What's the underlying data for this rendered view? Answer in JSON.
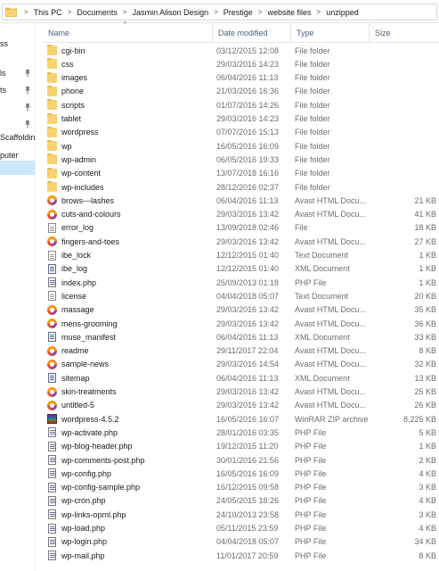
{
  "breadcrumbs": [
    "This PC",
    "Documents",
    "Jasmin Alison Design",
    "Prestige",
    "website files",
    "unzipped"
  ],
  "breadcrumb_separator": ">",
  "nav_pane": [
    {
      "label": "ss",
      "pinned": false,
      "selected": false
    },
    {
      "label": "ls",
      "pinned": true,
      "selected": false
    },
    {
      "label": "ts",
      "pinned": true,
      "selected": false
    },
    {
      "label": "",
      "pinned": true,
      "selected": false
    },
    {
      "label": "",
      "pinned": true,
      "selected": false
    },
    {
      "label": "Scaffoldin",
      "pinned": false,
      "selected": false
    },
    {
      "label": "puter",
      "pinned": false,
      "selected": false
    },
    {
      "label": "",
      "pinned": false,
      "selected": true
    }
  ],
  "columns": {
    "name": "Name",
    "date": "Date modified",
    "type": "Type",
    "size": "Size",
    "sort_indicator": "^"
  },
  "files": [
    {
      "name": "cgi-bin",
      "date": "03/12/2015 12:08",
      "type": "File folder",
      "size": "",
      "icon": "folder-icon"
    },
    {
      "name": "css",
      "date": "29/03/2016 14:23",
      "type": "File folder",
      "size": "",
      "icon": "folder-icon"
    },
    {
      "name": "images",
      "date": "06/04/2016 11:13",
      "type": "File folder",
      "size": "",
      "icon": "folder-icon"
    },
    {
      "name": "phone",
      "date": "21/03/2016 16:36",
      "type": "File folder",
      "size": "",
      "icon": "folder-icon"
    },
    {
      "name": "scripts",
      "date": "01/07/2016 14:26",
      "type": "File folder",
      "size": "",
      "icon": "folder-icon"
    },
    {
      "name": "tablet",
      "date": "29/03/2016 14:23",
      "type": "File folder",
      "size": "",
      "icon": "folder-icon"
    },
    {
      "name": "wordpress",
      "date": "07/07/2016 15:13",
      "type": "File folder",
      "size": "",
      "icon": "folder-icon"
    },
    {
      "name": "wp",
      "date": "16/05/2016 16:09",
      "type": "File folder",
      "size": "",
      "icon": "folder-icon"
    },
    {
      "name": "wp-admin",
      "date": "06/05/2016 19:33",
      "type": "File folder",
      "size": "",
      "icon": "folder-icon"
    },
    {
      "name": "wp-content",
      "date": "13/07/2018 16:16",
      "type": "File folder",
      "size": "",
      "icon": "folder-icon"
    },
    {
      "name": "wp-includes",
      "date": "28/12/2016 02:37",
      "type": "File folder",
      "size": "",
      "icon": "folder-icon"
    },
    {
      "name": "brows---lashes",
      "date": "06/04/2016 11:13",
      "type": "Avast HTML Docu...",
      "size": "21 KB",
      "icon": "avast-html-icon"
    },
    {
      "name": "cuts-and-colours",
      "date": "29/03/2016 13:42",
      "type": "Avast HTML Docu...",
      "size": "41 KB",
      "icon": "avast-html-icon"
    },
    {
      "name": "error_log",
      "date": "13/09/2018 02:46",
      "type": "File",
      "size": "18 KB",
      "icon": "document-icon"
    },
    {
      "name": "fingers-and-toes",
      "date": "29/03/2016 13:42",
      "type": "Avast HTML Docu...",
      "size": "27 KB",
      "icon": "avast-html-icon"
    },
    {
      "name": "ibe_lock",
      "date": "12/12/2015 01:40",
      "type": "Text Document",
      "size": "1 KB",
      "icon": "document-icon"
    },
    {
      "name": "ibe_log",
      "date": "12/12/2015 01:40",
      "type": "XML Document",
      "size": "1 KB",
      "icon": "xml-icon"
    },
    {
      "name": "index.php",
      "date": "25/09/2013 01:18",
      "type": "PHP File",
      "size": "1 KB",
      "icon": "php-icon"
    },
    {
      "name": "license",
      "date": "04/04/2018 05:07",
      "type": "Text Document",
      "size": "20 KB",
      "icon": "document-icon"
    },
    {
      "name": "massage",
      "date": "29/03/2016 13:42",
      "type": "Avast HTML Docu...",
      "size": "35 KB",
      "icon": "avast-html-icon"
    },
    {
      "name": "mens-grooming",
      "date": "29/03/2016 13:42",
      "type": "Avast HTML Docu...",
      "size": "36 KB",
      "icon": "avast-html-icon"
    },
    {
      "name": "muse_manifest",
      "date": "06/04/2016 11:13",
      "type": "XML Document",
      "size": "33 KB",
      "icon": "xml-icon"
    },
    {
      "name": "readme",
      "date": "29/11/2017 22:04",
      "type": "Avast HTML Docu...",
      "size": "8 KB",
      "icon": "avast-html-icon"
    },
    {
      "name": "sample-news",
      "date": "29/03/2016 14:54",
      "type": "Avast HTML Docu...",
      "size": "32 KB",
      "icon": "avast-html-icon"
    },
    {
      "name": "sitemap",
      "date": "06/04/2016 11:13",
      "type": "XML Document",
      "size": "13 KB",
      "icon": "xml-icon"
    },
    {
      "name": "skin-treatments",
      "date": "29/03/2016 13:42",
      "type": "Avast HTML Docu...",
      "size": "25 KB",
      "icon": "avast-html-icon"
    },
    {
      "name": "untitled-5",
      "date": "29/03/2016 13:42",
      "type": "Avast HTML Docu...",
      "size": "26 KB",
      "icon": "avast-html-icon"
    },
    {
      "name": "wordpress-4.5.2",
      "date": "16/05/2016 16:07",
      "type": "WinRAR ZIP archive",
      "size": "8,225 KB",
      "icon": "zip-archive-icon"
    },
    {
      "name": "wp-activate.php",
      "date": "28/01/2016 03:35",
      "type": "PHP File",
      "size": "5 KB",
      "icon": "php-icon"
    },
    {
      "name": "wp-blog-header.php",
      "date": "19/12/2015 11:20",
      "type": "PHP File",
      "size": "1 KB",
      "icon": "php-icon"
    },
    {
      "name": "wp-comments-post.php",
      "date": "30/01/2016 21:56",
      "type": "PHP File",
      "size": "2 KB",
      "icon": "php-icon"
    },
    {
      "name": "wp-config.php",
      "date": "16/05/2016 16:09",
      "type": "PHP File",
      "size": "4 KB",
      "icon": "php-icon"
    },
    {
      "name": "wp-config-sample.php",
      "date": "16/12/2015 09:58",
      "type": "PHP File",
      "size": "3 KB",
      "icon": "php-icon"
    },
    {
      "name": "wp-cron.php",
      "date": "24/05/2015 18:26",
      "type": "PHP File",
      "size": "4 KB",
      "icon": "php-icon"
    },
    {
      "name": "wp-links-opml.php",
      "date": "24/10/2013 23:58",
      "type": "PHP File",
      "size": "3 KB",
      "icon": "php-icon"
    },
    {
      "name": "wp-load.php",
      "date": "05/11/2015 23:59",
      "type": "PHP File",
      "size": "4 KB",
      "icon": "php-icon"
    },
    {
      "name": "wp-login.php",
      "date": "04/04/2018 05:07",
      "type": "PHP File",
      "size": "34 KB",
      "icon": "php-icon"
    },
    {
      "name": "wp-mail.php",
      "date": "11/01/2017 20:59",
      "type": "PHP File",
      "size": "8 KB",
      "icon": "php-icon"
    }
  ]
}
